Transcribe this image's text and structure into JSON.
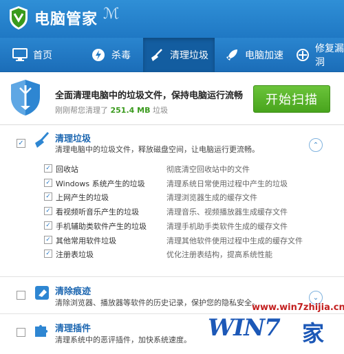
{
  "app": {
    "title": "电脑管家"
  },
  "nav": {
    "tabs": [
      {
        "label": "首页",
        "icon": "monitor-icon"
      },
      {
        "label": "杀毒",
        "icon": "virus-shield-icon"
      },
      {
        "label": "清理垃圾",
        "icon": "broom-icon",
        "active": true
      },
      {
        "label": "电脑加速",
        "icon": "rocket-icon"
      },
      {
        "label": "修复漏洞",
        "icon": "patch-icon"
      }
    ]
  },
  "banner": {
    "headline": "全面清理电脑中的垃圾文件，保持电脑运行流畅",
    "sub_prefix": "刚刚帮您清理了",
    "sub_size": "251.4 MB",
    "sub_suffix": "垃圾",
    "button_label": "开始扫描"
  },
  "sections": {
    "junk": {
      "title": "清理垃圾",
      "desc": "清理电脑中的垃圾文件，释放磁盘空间，让电脑运行更流畅。",
      "checked": true,
      "expanded": true,
      "items": [
        {
          "name": "回收站",
          "desc": "彻底清空回收站中的文件",
          "checked": true
        },
        {
          "name": "Windows 系统产生的垃圾",
          "desc": "清理系统日常使用过程中产生的垃圾",
          "checked": true
        },
        {
          "name": "上网产生的垃圾",
          "desc": "清理浏览器生成的缓存文件",
          "checked": true
        },
        {
          "name": "看视频听音乐产生的垃圾",
          "desc": "清理音乐、视频播放器生成缓存文件",
          "checked": true
        },
        {
          "name": "手机辅助类软件产生的垃圾",
          "desc": "清理手机助手类软件生成的缓存文件",
          "checked": true
        },
        {
          "name": "其他常用软件垃圾",
          "desc": "清理其他软件使用过程中生成的缓存文件",
          "checked": true
        },
        {
          "name": "注册表垃圾",
          "desc": "优化注册表结构，提高系统性能",
          "checked": true
        }
      ]
    },
    "traces": {
      "title": "清除痕迹",
      "desc": "清除浏览器、播放器等软件的历史记录，保护您的隐私安全。",
      "checked": false
    },
    "plugins": {
      "title": "清理插件",
      "desc": "清理系统中的恶评插件，加快系统速度。",
      "checked": false
    }
  },
  "watermark": {
    "url": "www.win7zhijia.cn",
    "logo_text": "WIN7",
    "logo_char": "家"
  },
  "colors": {
    "nav_blue": "#1f78c4",
    "active_tab": "#135da0",
    "start_green": "#48a41d",
    "section_title": "#1a65b0",
    "size_green": "#3a9a1d"
  }
}
